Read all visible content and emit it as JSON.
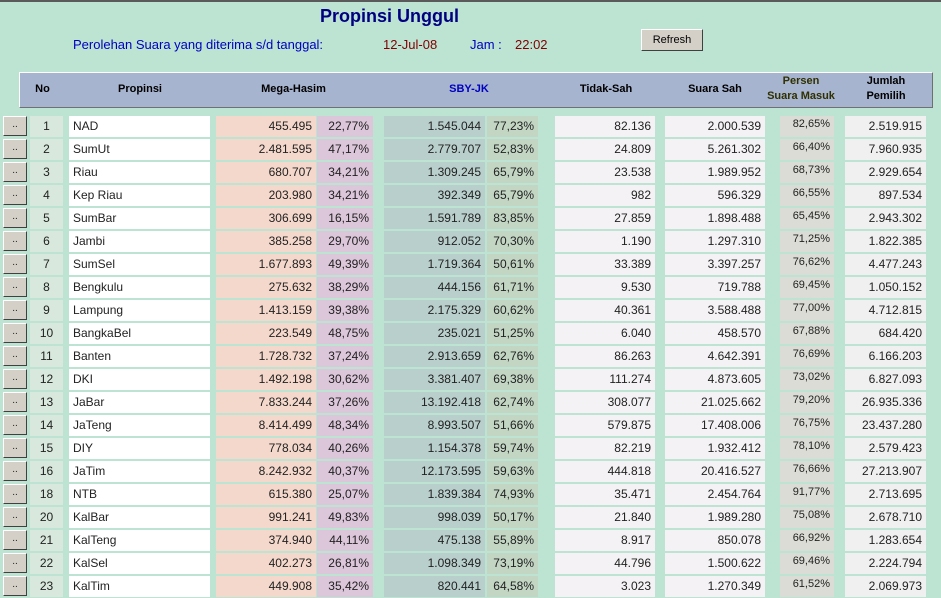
{
  "title": "Propinsi Unggul",
  "subtitle": {
    "label": "Perolehan Suara yang diterima s/d tanggal:",
    "date": "12-Jul-08",
    "jam_label": "Jam :",
    "time": "22:02"
  },
  "refresh_label": "Refresh",
  "row_button_label": "..",
  "colors": {
    "background": "#bde3d3",
    "header": "#a6b4cf",
    "mega": "#f5d8cc",
    "mega_pct": "#dcc6da",
    "sby": "#b9cfcc",
    "sby_pct": "#c3d6c4"
  },
  "headers": {
    "no": "No",
    "propinsi": "Propinsi",
    "mega": "Mega-Hasim",
    "sby": "SBY-JK",
    "tidak_sah": "Tidak-Sah",
    "suara_sah": "Suara Sah",
    "persen": "Persen\nSuara Masuk",
    "jumlah": "Jumlah\nPemilih"
  },
  "rows": [
    [
      "1",
      "NAD",
      "455.495",
      "22,77%",
      "1.545.044",
      "77,23%",
      "82.136",
      "2.000.539",
      "82,65%",
      "2.519.915"
    ],
    [
      "2",
      "SumUt",
      "2.481.595",
      "47,17%",
      "2.779.707",
      "52,83%",
      "24.809",
      "5.261.302",
      "66,40%",
      "7.960.935"
    ],
    [
      "3",
      "Riau",
      "680.707",
      "34,21%",
      "1.309.245",
      "65,79%",
      "23.538",
      "1.989.952",
      "68,73%",
      "2.929.654"
    ],
    [
      "4",
      "Kep Riau",
      "203.980",
      "34,21%",
      "392.349",
      "65,79%",
      "982",
      "596.329",
      "66,55%",
      "897.534"
    ],
    [
      "5",
      "SumBar",
      "306.699",
      "16,15%",
      "1.591.789",
      "83,85%",
      "27.859",
      "1.898.488",
      "65,45%",
      "2.943.302"
    ],
    [
      "6",
      "Jambi",
      "385.258",
      "29,70%",
      "912.052",
      "70,30%",
      "1.190",
      "1.297.310",
      "71,25%",
      "1.822.385"
    ],
    [
      "7",
      "SumSel",
      "1.677.893",
      "49,39%",
      "1.719.364",
      "50,61%",
      "33.389",
      "3.397.257",
      "76,62%",
      "4.477.243"
    ],
    [
      "8",
      "Bengkulu",
      "275.632",
      "38,29%",
      "444.156",
      "61,71%",
      "9.530",
      "719.788",
      "69,45%",
      "1.050.152"
    ],
    [
      "9",
      "Lampung",
      "1.413.159",
      "39,38%",
      "2.175.329",
      "60,62%",
      "40.361",
      "3.588.488",
      "77,00%",
      "4.712.815"
    ],
    [
      "10",
      "BangkaBel",
      "223.549",
      "48,75%",
      "235.021",
      "51,25%",
      "6.040",
      "458.570",
      "67,88%",
      "684.420"
    ],
    [
      "11",
      "Banten",
      "1.728.732",
      "37,24%",
      "2.913.659",
      "62,76%",
      "86.263",
      "4.642.391",
      "76,69%",
      "6.166.203"
    ],
    [
      "12",
      "DKI",
      "1.492.198",
      "30,62%",
      "3.381.407",
      "69,38%",
      "111.274",
      "4.873.605",
      "73,02%",
      "6.827.093"
    ],
    [
      "13",
      "JaBar",
      "7.833.244",
      "37,26%",
      "13.192.418",
      "62,74%",
      "308.077",
      "21.025.662",
      "79,20%",
      "26.935.336"
    ],
    [
      "14",
      "JaTeng",
      "8.414.499",
      "48,34%",
      "8.993.507",
      "51,66%",
      "579.875",
      "17.408.006",
      "76,75%",
      "23.437.280"
    ],
    [
      "15",
      "DIY",
      "778.034",
      "40,26%",
      "1.154.378",
      "59,74%",
      "82.219",
      "1.932.412",
      "78,10%",
      "2.579.423"
    ],
    [
      "16",
      "JaTim",
      "8.242.932",
      "40,37%",
      "12.173.595",
      "59,63%",
      "444.818",
      "20.416.527",
      "76,66%",
      "27.213.907"
    ],
    [
      "18",
      "NTB",
      "615.380",
      "25,07%",
      "1.839.384",
      "74,93%",
      "35.471",
      "2.454.764",
      "91,77%",
      "2.713.695"
    ],
    [
      "20",
      "KalBar",
      "991.241",
      "49,83%",
      "998.039",
      "50,17%",
      "21.840",
      "1.989.280",
      "75,08%",
      "2.678.710"
    ],
    [
      "21",
      "KalTeng",
      "374.940",
      "44,11%",
      "475.138",
      "55,89%",
      "8.917",
      "850.078",
      "66,92%",
      "1.283.654"
    ],
    [
      "22",
      "KalSel",
      "402.273",
      "26,81%",
      "1.098.349",
      "73,19%",
      "44.796",
      "1.500.622",
      "69,46%",
      "2.224.794"
    ],
    [
      "23",
      "KalTim",
      "449.908",
      "35,42%",
      "820.441",
      "64,58%",
      "3.023",
      "1.270.349",
      "61,52%",
      "2.069.973"
    ]
  ]
}
